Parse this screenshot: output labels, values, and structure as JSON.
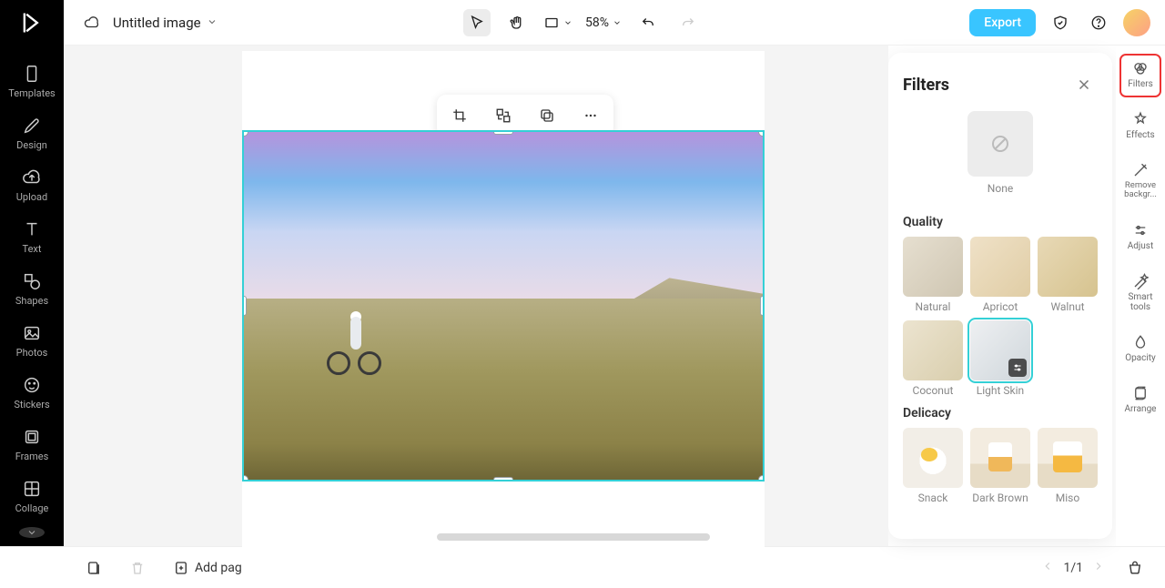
{
  "header": {
    "doc_title": "Untitled image",
    "zoom": "58%",
    "export_label": "Export"
  },
  "left_rail": {
    "items": [
      {
        "label": "Templates"
      },
      {
        "label": "Design"
      },
      {
        "label": "Upload"
      },
      {
        "label": "Text"
      },
      {
        "label": "Shapes"
      },
      {
        "label": "Photos"
      },
      {
        "label": "Stickers"
      },
      {
        "label": "Frames"
      },
      {
        "label": "Collage"
      }
    ]
  },
  "right_rail": {
    "items": [
      {
        "label": "Filters",
        "active": true
      },
      {
        "label": "Effects"
      },
      {
        "label": "Remove backgr..."
      },
      {
        "label": "Adjust"
      },
      {
        "label": "Smart tools"
      },
      {
        "label": "Opacity"
      },
      {
        "label": "Arrange"
      }
    ]
  },
  "filters_panel": {
    "title": "Filters",
    "none_label": "None",
    "sections": [
      {
        "title": "Quality",
        "items": [
          {
            "label": "Natural"
          },
          {
            "label": "Apricot"
          },
          {
            "label": "Walnut"
          },
          {
            "label": "Coconut"
          },
          {
            "label": "Light Skin",
            "selected": true
          }
        ]
      },
      {
        "title": "Delicacy",
        "items": [
          {
            "label": "Snack"
          },
          {
            "label": "Dark Brown"
          },
          {
            "label": "Miso"
          }
        ]
      }
    ]
  },
  "bottom": {
    "add_page_label": "Add page",
    "page_indicator": "1/1"
  }
}
